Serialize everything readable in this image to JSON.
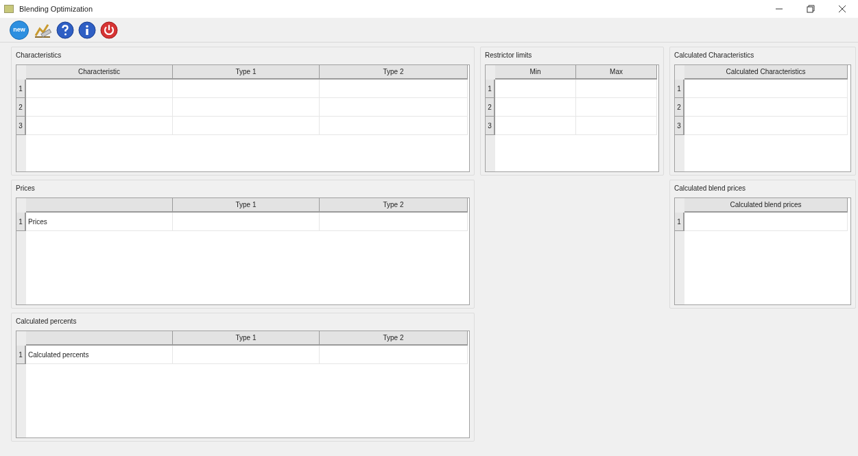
{
  "window": {
    "title": "Blending Optimization"
  },
  "toolbar": [
    {
      "kind": "new",
      "label": "new"
    },
    {
      "kind": "chart"
    },
    {
      "kind": "help"
    },
    {
      "kind": "info"
    },
    {
      "kind": "power"
    }
  ],
  "left_column": [
    {
      "title": "Characteristics",
      "columns": [
        {
          "title": "Characteristic"
        },
        {
          "title": "Type 1"
        },
        {
          "title": "Type 2"
        }
      ],
      "rows": [
        {
          "number": "1"
        },
        {
          "number": "2"
        },
        {
          "number": "3"
        }
      ]
    },
    {
      "title": "Prices",
      "columns": [
        {},
        {
          "title": "Type 1"
        },
        {
          "title": "Type 2"
        }
      ],
      "rows": [
        {
          "number": "1",
          "label": "Prices"
        }
      ]
    },
    {
      "title": "Calculated percents",
      "columns": [
        {},
        {
          "title": "Type 1"
        },
        {
          "title": "Type 2"
        }
      ],
      "rows": [
        {
          "number": "1",
          "label": "Calculated percents"
        }
      ]
    }
  ],
  "middle_column": [
    {
      "title": "Restrictor limits",
      "columns": [
        {
          "title": "Min"
        },
        {
          "title": "Max"
        }
      ],
      "rows": [
        {
          "number": "1"
        },
        {
          "number": "2"
        },
        {
          "number": "3"
        }
      ]
    }
  ],
  "right_column": [
    {
      "title": "Calculated Characteristics",
      "columns": [
        {
          "title": "Calculated Characteristics"
        }
      ],
      "rows": [
        {
          "number": "1"
        },
        {
          "number": "2"
        },
        {
          "number": "3"
        }
      ]
    },
    {
      "title": "Calculated blend prices",
      "columns": [
        {
          "title": "Calculated blend prices"
        }
      ],
      "rows": [
        {
          "number": "1"
        }
      ]
    }
  ]
}
